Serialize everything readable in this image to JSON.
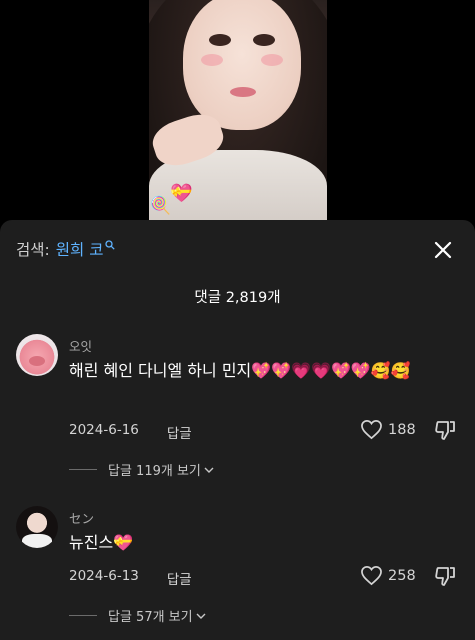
{
  "video": {
    "stickers": [
      "💝",
      "🍭"
    ]
  },
  "sheet": {
    "search_prefix": "검색:",
    "search_query": "원희 코",
    "close_icon": "close-icon",
    "comment_count": "댓글 2,819개",
    "accent_color": "#5fb3ff",
    "background": "#1e1e1e"
  },
  "comments": [
    {
      "user": "오잇",
      "text": "해린 혜인 다니엘 하니 민지💖💖💗💗💖💖🥰🥰",
      "date": "2024-6-16",
      "reply_label": "답글",
      "likes": "188",
      "more_replies": "답글 119개 보기"
    },
    {
      "user": "セン",
      "text": "뉴진스💝",
      "date": "2024-6-13",
      "reply_label": "답글",
      "likes": "258",
      "more_replies": "답글 57개 보기"
    }
  ]
}
